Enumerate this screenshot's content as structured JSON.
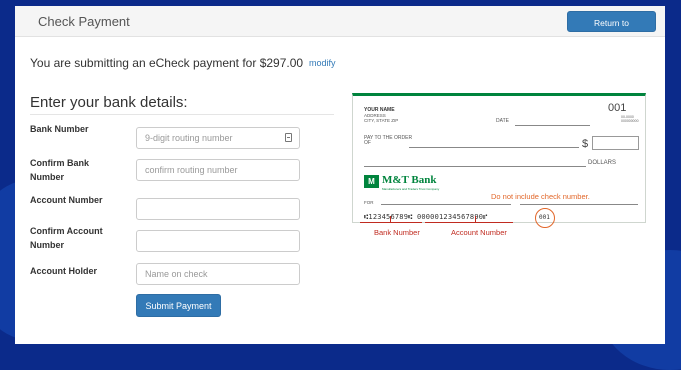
{
  "header": {
    "title": "Check Payment",
    "return_label": "Return to Financials"
  },
  "summary": {
    "text": "You are submitting an eCheck payment for $297.00",
    "modify_label": "modify"
  },
  "form": {
    "section_title": "Enter your bank details:",
    "fields": [
      {
        "label": "Bank Number",
        "placeholder": "9-digit routing number",
        "value": ""
      },
      {
        "label": "Confirm Bank Number",
        "placeholder": "confirm routing number",
        "value": ""
      },
      {
        "label": "Account Number",
        "placeholder": "",
        "value": ""
      },
      {
        "label": "Confirm Account Number",
        "placeholder": "",
        "value": ""
      },
      {
        "label": "Account Holder",
        "placeholder": "Name on check",
        "value": ""
      }
    ],
    "submit_label": "Submit Payment"
  },
  "check_image": {
    "your_name": "YOUR NAME",
    "address": "ADDRESS",
    "city_state_zip": "CITY, STATE ZIP",
    "check_number": "001",
    "fraction": "00-0000 000000000",
    "date_label": "DATE",
    "pay_to_label": "PAY TO THE ORDER OF",
    "dollar_sign": "$",
    "dollars_label": "DOLLARS",
    "bank_name": "M&T Bank",
    "bank_logo": "M",
    "bank_sub": "Manufacturers and Traders Trust Company",
    "note": "Do not include check number.",
    "for_label": "FOR",
    "micr_line": "⑆123456789⑆ 000001234567890⑈",
    "micr_check_number": "001",
    "bank_number_label": "Bank Number",
    "account_number_label": "Account Number"
  },
  "colors": {
    "accent": "#337ab7",
    "bank_green": "#00843d",
    "annotation_orange": "#e2672a",
    "annotation_red": "#c02b20",
    "background": "#0b2a8a"
  }
}
